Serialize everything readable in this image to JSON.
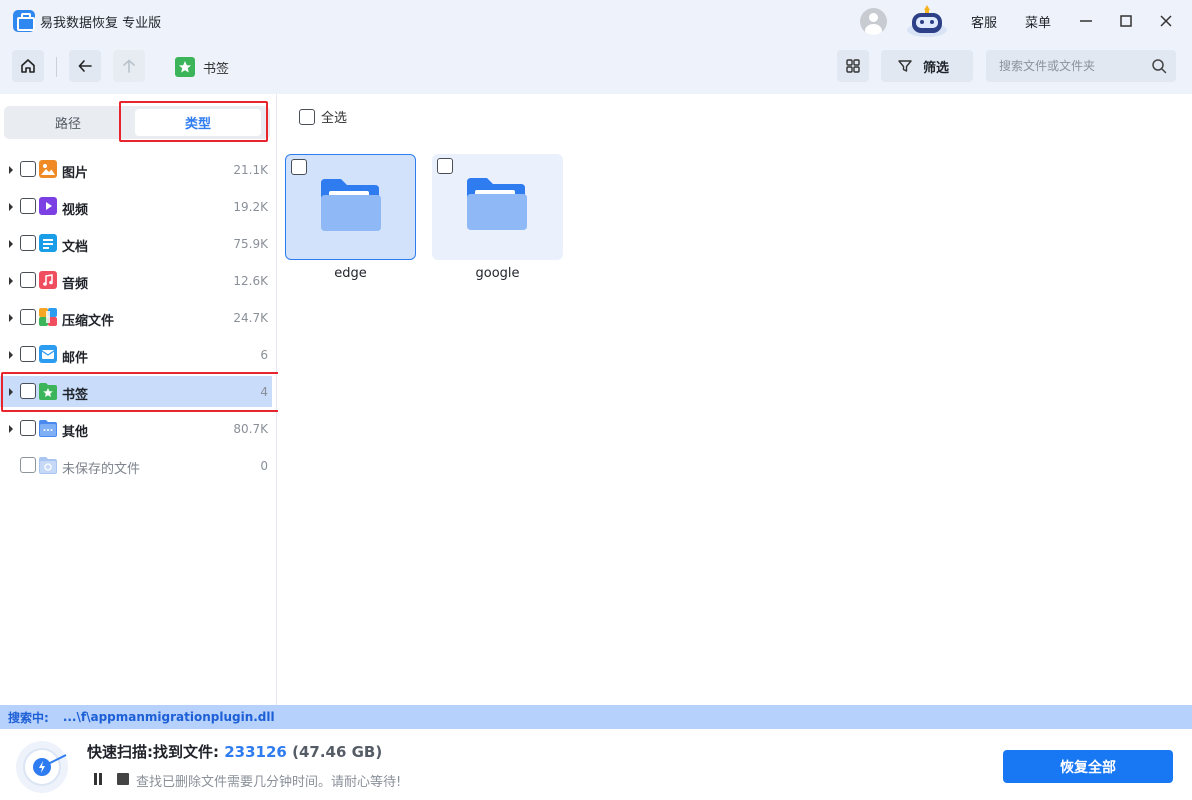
{
  "app": {
    "title": "易我数据恢复 专业版"
  },
  "titlebar": {
    "support_label": "客服",
    "menu_label": "菜单"
  },
  "toolbar": {
    "breadcrumb": "书签",
    "filter_label": "筛选",
    "search_placeholder": "搜索文件或文件夹"
  },
  "sidebar": {
    "tabs": {
      "path": "路径",
      "type": "类型"
    },
    "categories": [
      {
        "label": "图片",
        "count": "21.1K",
        "icon": "image-icon",
        "color": "#f08a24"
      },
      {
        "label": "视频",
        "count": "19.2K",
        "icon": "video-icon",
        "color": "#7b3fe4"
      },
      {
        "label": "文档",
        "count": "75.9K",
        "icon": "document-icon",
        "color": "#1a9ee8"
      },
      {
        "label": "音频",
        "count": "12.6K",
        "icon": "audio-icon",
        "color": "#f04e5e"
      },
      {
        "label": "压缩文件",
        "count": "24.7K",
        "icon": "archive-icon",
        "color": "#f5a623"
      },
      {
        "label": "邮件",
        "count": "6",
        "icon": "mail-icon",
        "color": "#2c9cf0"
      },
      {
        "label": "书签",
        "count": "4",
        "icon": "bookmark-icon",
        "color": "#3cb45a"
      },
      {
        "label": "其他",
        "count": "80.7K",
        "icon": "other-folder-icon",
        "color": "#4a8af0"
      },
      {
        "label": "未保存的文件",
        "count": "0",
        "icon": "unsaved-folder-icon",
        "color": "#a9c6f2"
      }
    ]
  },
  "main": {
    "select_all_label": "全选",
    "files": [
      {
        "name": "edge"
      },
      {
        "name": "google"
      }
    ]
  },
  "status": {
    "searching_label": "搜索中:",
    "searching_path": "...\\f\\appmanmigrationplugin.dll"
  },
  "scan": {
    "title_prefix": "快速扫描:找到文件:",
    "count": "233126",
    "size": "(47.46 GB)",
    "hint": "查找已删除文件需要几分钟时间。请耐心等待!",
    "recover_all_label": "恢复全部"
  }
}
